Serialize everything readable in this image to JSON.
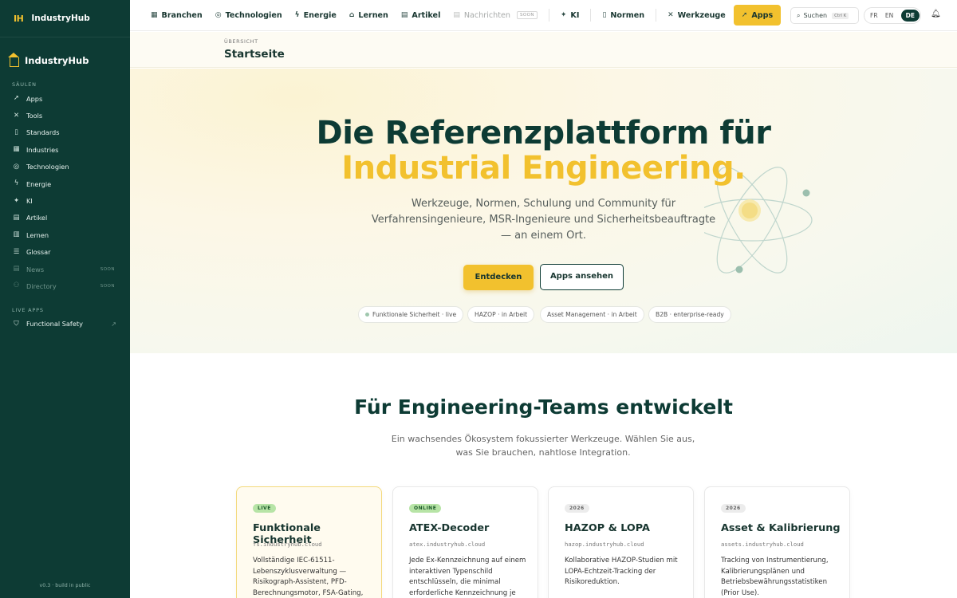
{
  "sidebar": {
    "brand_logo": "IH",
    "brand_name": "IndustryHub",
    "home_label": "IndustryHub",
    "section_pillars": "SÄULEN",
    "items": [
      {
        "label": "Apps",
        "icon": "rocket-icon"
      },
      {
        "label": "Tools",
        "icon": "tools-icon"
      },
      {
        "label": "Standards",
        "icon": "bookmark-icon"
      },
      {
        "label": "Industries",
        "icon": "building-icon"
      },
      {
        "label": "Technologien",
        "icon": "chip-icon"
      },
      {
        "label": "Energie",
        "icon": "bolt-icon"
      },
      {
        "label": "KI",
        "icon": "sparkle-icon"
      },
      {
        "label": "Artikel",
        "icon": "document-icon"
      },
      {
        "label": "Lernen",
        "icon": "book-icon"
      },
      {
        "label": "Glossar",
        "icon": "list-icon"
      },
      {
        "label": "News",
        "icon": "newspaper-icon",
        "soon": "SOON"
      },
      {
        "label": "Directory",
        "icon": "users-icon",
        "soon": "SOON"
      }
    ],
    "section_live": "LIVE APPS",
    "live_items": [
      {
        "label": "Functional Safety",
        "icon": "shield-icon"
      }
    ],
    "footer": "v0.3 · build in public"
  },
  "topnav": {
    "items": [
      {
        "label": "Branchen",
        "icon": "building-icon"
      },
      {
        "label": "Technologien",
        "icon": "chip-icon"
      },
      {
        "label": "Energie",
        "icon": "bolt-icon"
      },
      {
        "label": "Lernen",
        "icon": "graduation-icon"
      },
      {
        "label": "Artikel",
        "icon": "document-icon"
      },
      {
        "label": "Nachrichten",
        "icon": "newspaper-icon",
        "soon": "SOON"
      },
      {
        "label": "KI",
        "icon": "sparkle-icon"
      },
      {
        "label": "Normen",
        "icon": "bookmark-icon"
      },
      {
        "label": "Werkzeuge",
        "icon": "tools-icon"
      },
      {
        "label": "Apps",
        "icon": "rocket-icon"
      }
    ],
    "search_label": "Suchen",
    "search_kbd": "Ctrl K",
    "langs": [
      "FR",
      "EN",
      "DE"
    ],
    "active_lang": "DE"
  },
  "page": {
    "crumb": "ÜBERSICHT",
    "title": "Startseite"
  },
  "hero": {
    "title_line1": "Die Referenzplattform für",
    "title_line2": "Industrial Engineering.",
    "subtitle": "Werkzeuge, Normen, Schulung und Community für Verfahrensingenieure, MSR-Ingenieure und Sicherheitsbeauftragte — an einem Ort.",
    "primary_button": "Entdecken",
    "secondary_button": "Apps ansehen",
    "pills": [
      "Funktionale Sicherheit · live",
      "HAZOP · in Arbeit",
      "Asset Management · in Arbeit",
      "B2B · enterprise-ready"
    ]
  },
  "section": {
    "title": "Für Engineering-Teams entwickelt",
    "subtitle": "Ein wachsendes Ökosystem fokussierter Werkzeuge. Wählen Sie aus, was Sie brauchen, nahtlose Integration."
  },
  "cards": [
    {
      "badge": "LIVE",
      "title": "Funktionale Sicherheit",
      "url": "fs.industryhub.cloud",
      "desc": "Vollständige IEC-61511-Lebenszyklusverwaltung — Risikograph-Assistent, PFD-Berechnungsmotor, FSA-Gating,"
    },
    {
      "badge": "ONLINE",
      "title": "ATEX-Decoder",
      "url": "atex.industryhub.cloud",
      "desc": "Jede Ex-Kennzeichnung auf einem interaktiven Typenschild entschlüsseln, die minimal erforderliche Kennzeichnung je"
    },
    {
      "badge": "2026",
      "title": "HAZOP & LOPA",
      "url": "hazop.industryhub.cloud",
      "desc": "Kollaborative HAZOP-Studien mit LOPA-Echtzeit-Tracking der Risikoreduktion."
    },
    {
      "badge": "2026",
      "title": "Asset & Kalibrierung",
      "url": "assets.industryhub.cloud",
      "desc": "Tracking von Instrumentierung, Kalibrierungsplänen und Betriebsbewährungsstatistiken (Prior Use)."
    }
  ],
  "colors": {
    "sidebar_bg": "#0d3b34",
    "accent": "#f2c12e",
    "live_badge": "#b7e4a6"
  }
}
